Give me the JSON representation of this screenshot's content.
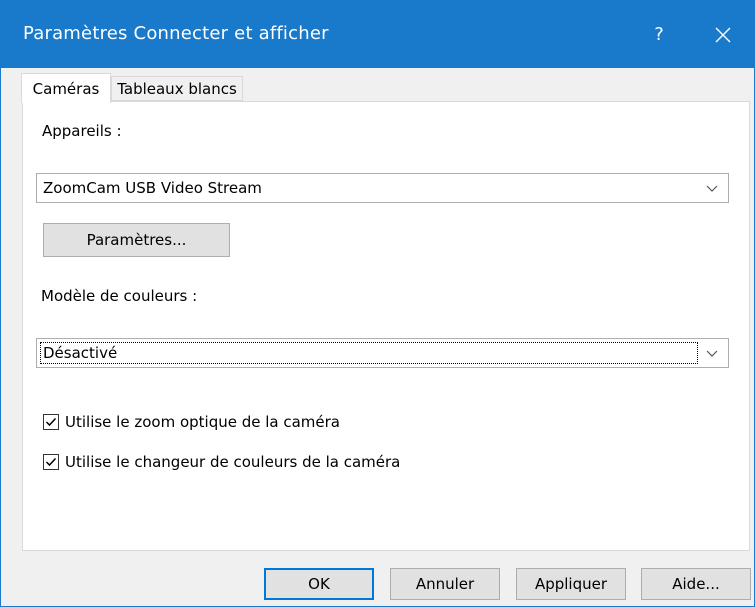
{
  "window": {
    "title": "Paramètres Connecter et afficher",
    "help_label": "?",
    "accent": "#1979ca"
  },
  "tabs": [
    {
      "label": "Caméras",
      "active": true
    },
    {
      "label": "Tableaux blancs",
      "active": false
    }
  ],
  "cameras": {
    "devices_label": "Appareils :",
    "device_value": "ZoomCam USB Video Stream",
    "settings_button": "Paramètres...",
    "color_model_label": "Modèle de couleurs :",
    "color_model_value": "Désactivé",
    "checkboxes": [
      {
        "label": "Utilise le zoom optique de la caméra",
        "checked": true
      },
      {
        "label": "Utilise le changeur de couleurs de la caméra",
        "checked": true
      }
    ]
  },
  "buttons": {
    "ok": "OK",
    "cancel": "Annuler",
    "apply": "Appliquer",
    "help": "Aide..."
  }
}
